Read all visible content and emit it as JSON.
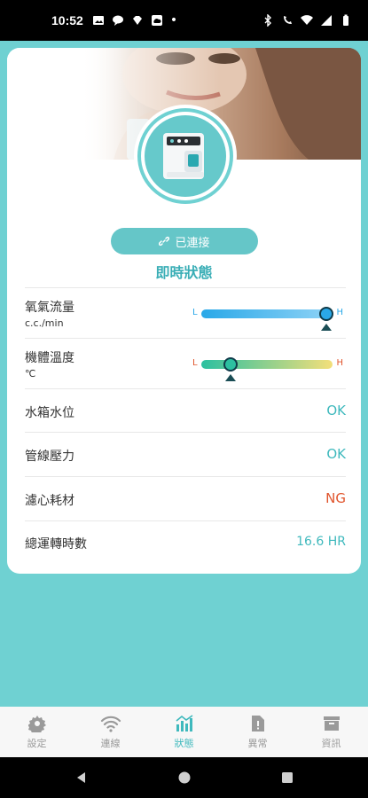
{
  "status_bar": {
    "time": "10:52",
    "dot": "•"
  },
  "connect_button": {
    "label": "已連接",
    "icon": "link-icon"
  },
  "section_title": "即時狀態",
  "gauges": [
    {
      "label": "氧氣流量",
      "unit": "c.c./min",
      "low": "L",
      "high": "H",
      "level": 0.95,
      "color_start": "#2aa8e8",
      "color_end": "#8fd3f6"
    },
    {
      "label": "機體溫度",
      "unit": "℃",
      "low": "L",
      "high": "H",
      "level": 0.22,
      "color_start": "#2cc0a0",
      "color_end": "#f3df7a"
    }
  ],
  "status_rows": [
    {
      "label": "水箱水位",
      "value": "OK",
      "state": "ok"
    },
    {
      "label": "管線壓力",
      "value": "OK",
      "state": "ok"
    },
    {
      "label": "濾心耗材",
      "value": "NG",
      "state": "ng"
    },
    {
      "label": "總運轉時數",
      "value": "16.6 HR",
      "state": "ok"
    }
  ],
  "bottom_nav": [
    {
      "label": "設定",
      "icon": "gear-icon",
      "active": false
    },
    {
      "label": "連線",
      "icon": "wifi-icon",
      "active": false
    },
    {
      "label": "狀態",
      "icon": "chart-icon",
      "active": true
    },
    {
      "label": "異常",
      "icon": "alert-document-icon",
      "active": false
    },
    {
      "label": "資訊",
      "icon": "archive-icon",
      "active": false
    }
  ],
  "colors": {
    "accent": "#3fb9bd",
    "background": "#6fd1d2",
    "ng": "#e0552d"
  }
}
